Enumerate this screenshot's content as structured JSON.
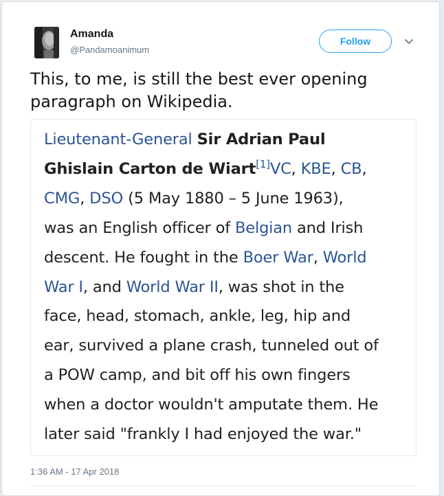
{
  "author": {
    "name": "Amanda",
    "handle": "@Pandamoanimum"
  },
  "follow_label": "Follow",
  "caret_icon": "chevron-down-icon",
  "tweet_text": "This, to me, is still the best ever opening paragraph on Wikipedia.",
  "image": {
    "line1": {
      "a": "Lieutenant-General",
      "b": "Sir Adrian Paul"
    },
    "line2": {
      "b": "Ghislain Carton de Wiart",
      "sup": "[1]",
      "a1": "VC",
      "t1": ", ",
      "a2": "KBE",
      "t2": ", ",
      "a3": "CB",
      "t3": ","
    },
    "line3": {
      "a1": "CMG",
      "t1": ", ",
      "a2": "DSO",
      "t2": " (5 May 1880 – 5 June 1963),"
    },
    "line4": {
      "t1": "was an English officer of ",
      "a1": "Belgian",
      "t2": " and Irish"
    },
    "line5": {
      "t1": "descent. He fought in the ",
      "a1": "Boer War",
      "t2": ", ",
      "a2": "World"
    },
    "line6": {
      "a1": "War I",
      "t1": ", and ",
      "a2": "World War II",
      "t2": ", was shot in the"
    },
    "line7": "face, head, stomach, ankle, leg, hip and",
    "line8": "ear, survived a plane crash, tunneled out of",
    "line9": "a POW camp, and bit off his own fingers",
    "line10": "when a doctor wouldn't amputate them. He",
    "line11": "later said \"frankly I had enjoyed the war.\""
  },
  "timestamp": "1:36 AM - 17 Apr 2018",
  "colors": {
    "link": "#1da1f2",
    "wiki_link": "#2b5494",
    "secondary": "#657786"
  }
}
